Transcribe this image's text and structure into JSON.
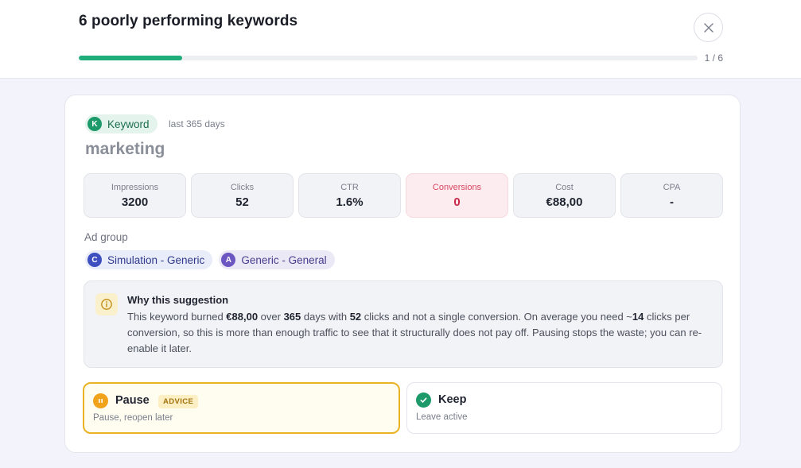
{
  "header": {
    "title": "6 poorly performing keywords",
    "progress": {
      "current": 1,
      "total": 6,
      "label": "1 / 6",
      "fraction": 0.1667
    }
  },
  "colors": {
    "accent_green": "#1fae7b",
    "danger": "#c82849",
    "advice_border": "#eab324",
    "keep_green": "#1c9a6a"
  },
  "keyword_card": {
    "badge_letter": "K",
    "badge_label": "Keyword",
    "period": "last 365 days",
    "keyword": "marketing",
    "metrics": [
      {
        "label": "Impressions",
        "value": "3200"
      },
      {
        "label": "Clicks",
        "value": "52"
      },
      {
        "label": "CTR",
        "value": "1.6%"
      },
      {
        "label": "Conversions",
        "value": "0"
      },
      {
        "label": "Cost",
        "value": "€88,00"
      },
      {
        "label": "CPA",
        "value": "-"
      }
    ],
    "ad_group_label": "Ad group",
    "ad_groups": [
      {
        "letter": "C",
        "name": "Simulation - Generic",
        "color": "#3e4fc0"
      },
      {
        "letter": "A",
        "name": "Generic - General",
        "color": "#6b56c2"
      }
    ]
  },
  "suggestion": {
    "icon": "info-icon",
    "title": "Why this suggestion",
    "body": {
      "p1": "This keyword burned ",
      "cost": "€88,00",
      "p2": " over ",
      "days": "365",
      "p3": " days with ",
      "clicks": "52",
      "p4": " clicks and not a single conversion. On average you need ~",
      "needed": "14",
      "p5": " clicks per conversion, so this is more than enough traffic to see that it structurally does not pay off. Pausing stops the waste; you can re-enable it later."
    }
  },
  "options": {
    "pause": {
      "title": "Pause",
      "badge": "ADVICE",
      "subtitle": "Pause, reopen later",
      "icon": "pause-icon"
    },
    "keep": {
      "title": "Keep",
      "subtitle": "Leave active",
      "icon": "check-icon"
    }
  }
}
